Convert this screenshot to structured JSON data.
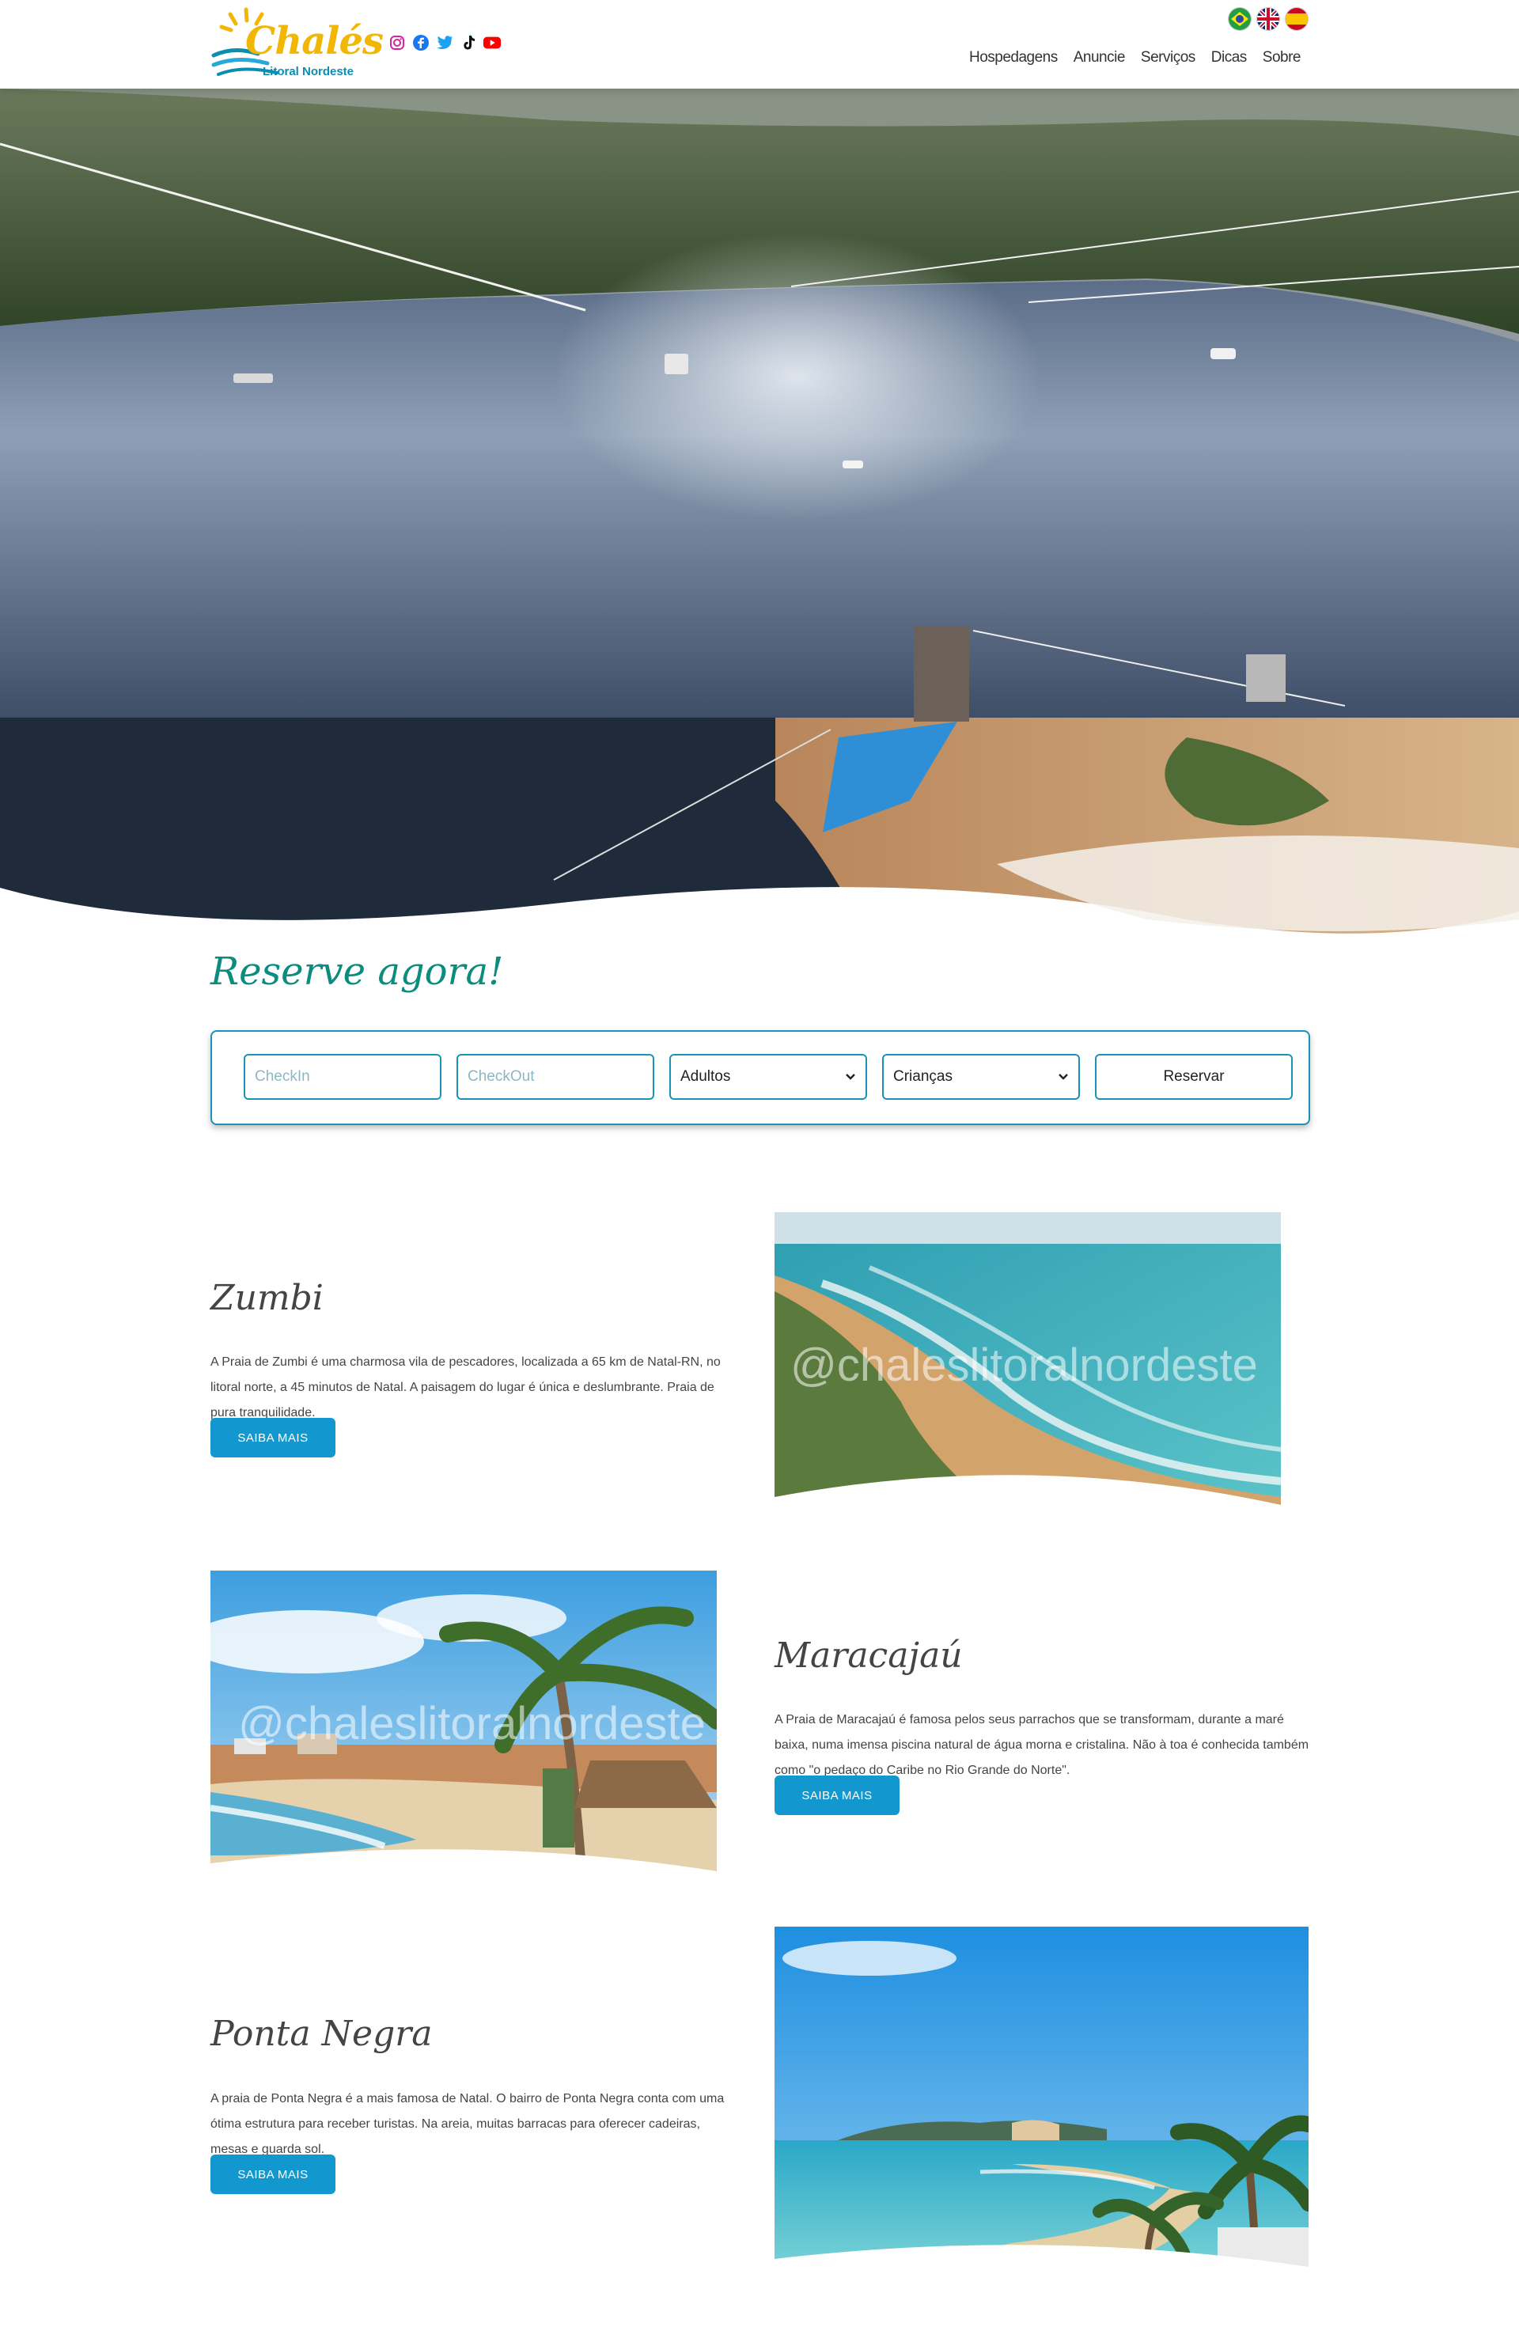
{
  "header": {
    "logo_text": "Chalés",
    "logo_subtext": "Litoral Nordeste",
    "socials": [
      "instagram-icon",
      "facebook-icon",
      "twitter-icon",
      "tiktok-icon",
      "youtube-icon"
    ],
    "languages": [
      "pt-BR",
      "en-GB",
      "es"
    ],
    "nav": [
      "Hospedagens",
      "Anuncie",
      "Serviços",
      "Dicas",
      "Sobre"
    ]
  },
  "booking": {
    "title": "Reserve agora!",
    "checkin_placeholder": "CheckIn",
    "checkout_placeholder": "CheckOut",
    "adults_label": "Adultos",
    "children_label": "Crianças",
    "submit_label": "Reservar"
  },
  "sections": [
    {
      "title": "Zumbi",
      "text": "A Praia de Zumbi é uma charmosa vila de pescadores, localizada a 65 km de Natal-RN, no litoral norte, a 45 minutos de Natal. A paisagem do lugar é única e deslumbrante. Praia de pura tranquilidade.",
      "button": "SAIBA MAIS",
      "watermark": "@chaleslitoralnordeste"
    },
    {
      "title": "Maracajaú",
      "text": "A Praia de Maracajaú é famosa pelos seus parrachos que se transformam, durante a maré baixa, numa imensa piscina natural de água morna e cristalina. Não à toa é conhecida também como \"o pedaço do Caribe no Rio Grande do Norte\".",
      "button": "SAIBA MAIS",
      "watermark": "@chaleslitoralnordeste"
    },
    {
      "title": "Ponta Negra",
      "text": "A praia de Ponta Negra é a mais famosa de Natal. O bairro de Ponta Negra conta com uma ótima estrutura para receber turistas. Na areia, muitas barracas para oferecer cadeiras, mesas e guarda sol.",
      "button": "SAIBA MAIS"
    }
  ],
  "colors": {
    "accent": "#1298cf",
    "border": "#1b93b9",
    "title_green": "#0a8c7e",
    "logo_yellow": "#f2b705"
  }
}
